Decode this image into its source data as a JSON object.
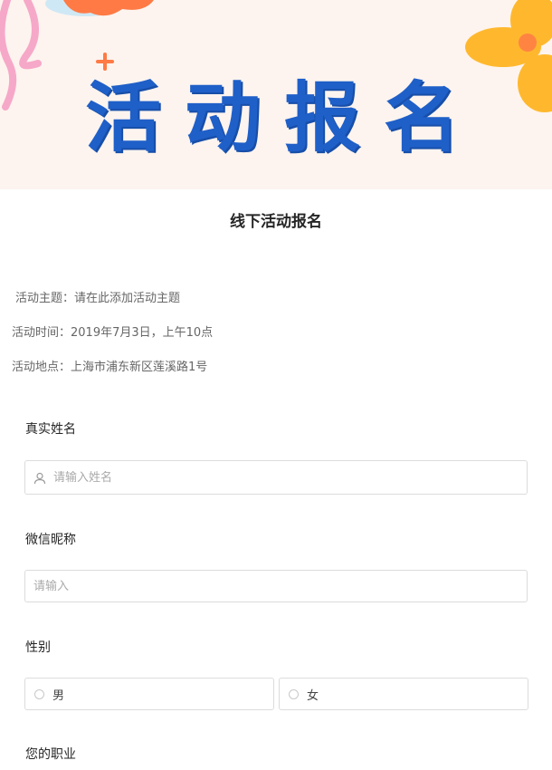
{
  "banner": {
    "title": "活动报名",
    "colors": {
      "background": "#fdf4ef",
      "title": "#1f5fc8",
      "flower_orange": "#ff7a45",
      "flower_yellow": "#ffb82e",
      "pink": "#f6a8c8"
    }
  },
  "form": {
    "title": "线下活动报名",
    "info": {
      "theme": "活动主题：请在此添加活动主题",
      "time": "活动时间：2019年7月3日，上午10点",
      "place": "活动地点：上海市浦东新区莲溪路1号"
    },
    "fields": {
      "name": {
        "label": "真实姓名",
        "placeholder": "请输入姓名",
        "icon": "user-icon"
      },
      "wechat": {
        "label": "微信昵称",
        "placeholder": "请输入"
      },
      "gender": {
        "label": "性别",
        "options": [
          "男",
          "女"
        ]
      },
      "job": {
        "label": "您的职业"
      }
    }
  }
}
